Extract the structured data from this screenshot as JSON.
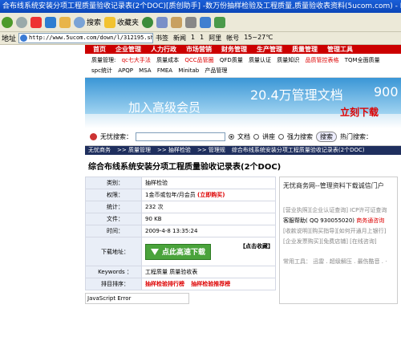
{
  "window": {
    "title": "合布线系统安装分项工程质量验收记录表(2个DOC)[质创助手] -数万份抽样检验及工程质量,质量验收表资料(5ucom.com) - Microsoft"
  },
  "toolbar": {
    "search_label": "搜索",
    "favorites_label": "收藏夹"
  },
  "addressbar": {
    "url": "http://www.5ucom.com/down/l/312195.shtml",
    "links": [
      "书签",
      "新闻",
      "1",
      "1",
      "阿里",
      "帐号",
      "15~27℃"
    ]
  },
  "site_nav": [
    "首页",
    "企业管理",
    "人力行政",
    "市场营销",
    "财务管理",
    "生产管理",
    "质量管理",
    "管理工具"
  ],
  "subnav": {
    "label": "质量管理:",
    "line1": [
      "qc七大手法",
      "质量成本",
      "QCC品管圈",
      "QFD质量",
      "质量认证",
      "质量知识",
      "品质管控表格",
      "TQM全面质量"
    ],
    "line2": [
      "spc统计",
      "APQP",
      "MSA",
      "FMEA",
      "Minitab",
      "产品管理"
    ]
  },
  "banner": {
    "left_text": "加入高级会员",
    "right_text": "20.4万管理文档",
    "cut_text": "900",
    "button": "立刻下载"
  },
  "search": {
    "label": "无忧搜索：",
    "radio_doc": "文档",
    "radio_lesson": "讲座",
    "radio_strong": "强力搜索",
    "button": "搜索",
    "hot": "热门搜索："
  },
  "breadcrumb": [
    "无忧商务",
    ">> 质量管理",
    ">> 抽样检验",
    ">> 管理规",
    "综合布线系统安装分项工程质量验收记录表(2个DOC)"
  ],
  "page_title": "综合布线系统安装分项工程质量验收记录表(2个DOC)",
  "info": {
    "rows": [
      {
        "k": "类别：",
        "v": "抽样检验"
      },
      {
        "k": "权限：",
        "v": "1金币或包年/月会员",
        "extra": "(立即购买)"
      },
      {
        "k": "统计：",
        "v": "232 次"
      },
      {
        "k": "文件：",
        "v": "90 KB"
      },
      {
        "k": "时间：",
        "v": "2009-4-8 13:35:24"
      }
    ],
    "download_label": "下载地址：",
    "download_button": "点此高速下载",
    "collect": "【点击收藏】",
    "keywords_label": "Keywords ：",
    "keywords_value": "工程质量 质量验收表",
    "rank_label": "排目排序：",
    "rank_v1": "抽样检验排行榜",
    "rank_v2": "抽样检验推荐榜",
    "js_error": "JavaScript Error"
  },
  "side": {
    "header": "无忧商务网--管理资料下载诚信门户",
    "line1": "[营业执照][企业认证查询] ICP许可证查询",
    "line2": "客服帮助( QQ 930055020)",
    "line2_strong": "商务通咨询",
    "line3": "[收款说明][购买指导][如何开通月上银行]",
    "line4": "[企业发票购买][免费店铺] [在线咨询]",
    "tools": "常用工具： 迅雷 . 超级解压 . 最伤酷音 . ·"
  }
}
